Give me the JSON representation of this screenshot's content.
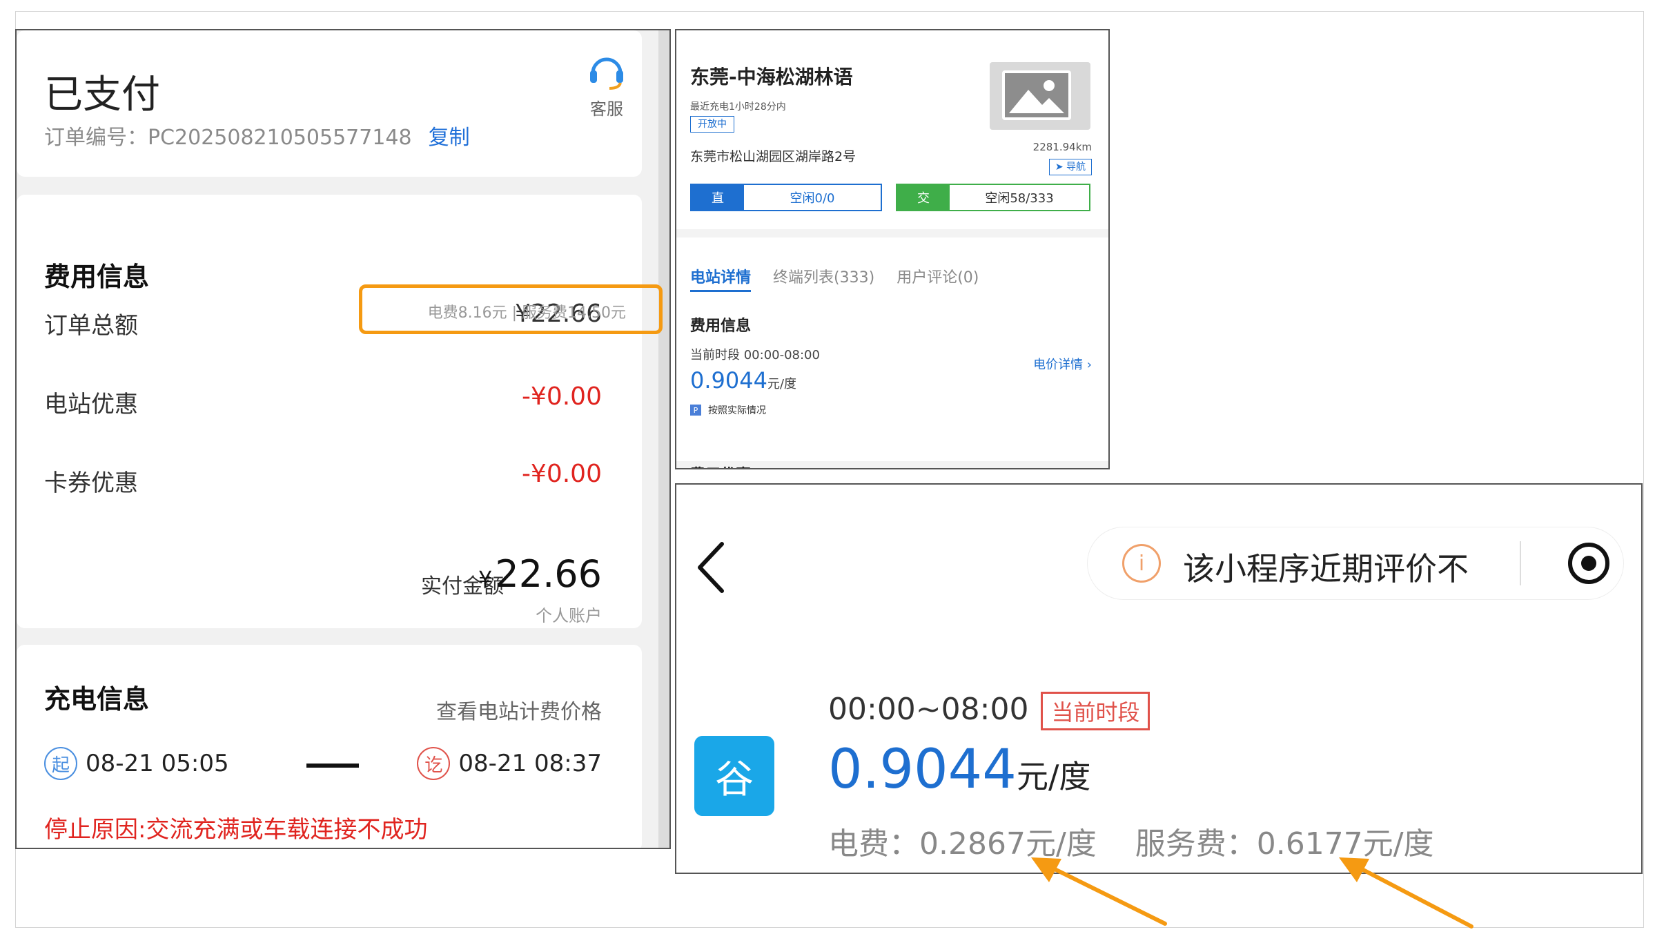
{
  "order": {
    "status_title": "已支付",
    "order_no_label": "订单编号：",
    "order_no": "PC2025082105055771​48",
    "copy_label": "复制",
    "service_label": "客服"
  },
  "fees": {
    "section_title": "费用信息",
    "total_label": "订单总额",
    "total_value": "¥22.66",
    "breakdown": "电费8.16元 | 服务费14.50元",
    "station_discount_label": "电站优惠",
    "station_discount_value": "-¥0.00",
    "coupon_discount_label": "卡券优惠",
    "coupon_discount_value": "-¥0.00",
    "paid_label": "实付金额",
    "paid_symbol": "¥",
    "paid_value": "22.66",
    "paid_account": "个人账户"
  },
  "charge": {
    "section_title": "充电信息",
    "view_price_label": "查看电站计费价格",
    "start_icon": "起",
    "start_time": "08-21 05:05",
    "end_icon": "讫",
    "end_time": "08-21 08:37",
    "stop_reason": "停止原因:交流充满或车载连接不成功"
  },
  "station": {
    "name": "东莞-中海松湖林语",
    "recent": "最近充电1小时28分内",
    "open_badge": "开放中",
    "address": "东莞市松山湖园区湖岸路2号",
    "distance": "2281.94km",
    "nav_label": "➤ 导航",
    "dc_tag": "直",
    "dc_idle": "空闲0/0",
    "ac_tag": "交",
    "ac_idle": "空闲58/333",
    "tabs": [
      "电站详情",
      "终端列表(333)",
      "用户评论(0)"
    ],
    "fee_header": "费用信息",
    "current_period": "当前时段 00:00-08:00",
    "price_detail": "电价详情 ›",
    "price_value": "0.9044",
    "price_unit": "元/度",
    "note_icon": "P",
    "note": "按照实际情况",
    "next_section": "费用优惠"
  },
  "miniapp": {
    "capsule_text": "该小程序近期评价不",
    "info_icon": "i",
    "period_time": "00:00~08:00",
    "period_badge": "当前时段",
    "valley_label": "谷",
    "price_value": "0.9044",
    "price_unit": "元/度",
    "elec_fee": "电费：0.2867元/度",
    "service_fee": "服务费：0.6177元/度"
  },
  "colors": {
    "highlight_orange": "#f59a12",
    "brand_blue": "#1e6fd0",
    "red": "#e0241f",
    "valley_blue": "#1aa7e8",
    "ac_green": "#3fae49"
  }
}
